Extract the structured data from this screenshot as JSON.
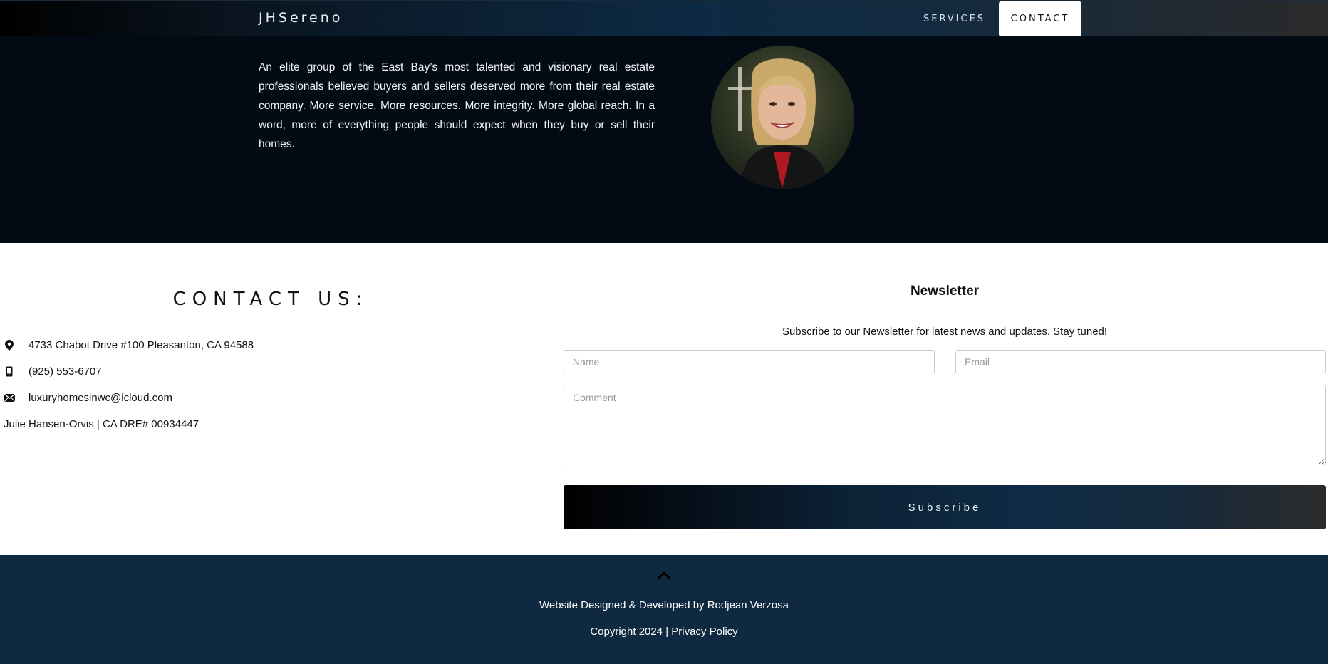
{
  "nav": {
    "brand": "JHSereno",
    "items": [
      {
        "label": "SERVICES"
      },
      {
        "label": "CONTACT"
      }
    ]
  },
  "about": {
    "text": "An elite group of the East Bay’s most talented and visionary real estate professionals believed buyers and sellers deserved more from their real estate company. More service. More resources. More integrity. More global reach. In a word, more of everything people should expect when they buy or sell their homes.",
    "portrait_icon": "agent-portrait-photo"
  },
  "contact": {
    "title": "CONTACT US:",
    "address": "4733 Chabot Drive #100 Pleasanton, CA 94588",
    "phone": "(925) 553-6707",
    "email": "luxuryhomesinwc@icloud.com",
    "license": "Julie Hansen-Orvis | CA DRE# 00934447",
    "icons": [
      "map-pin-icon",
      "phone-icon",
      "envelope-icon"
    ]
  },
  "newsletter": {
    "title": "Newsletter",
    "subtitle": "Subscribe to our Newsletter for latest news and updates. Stay tuned!",
    "name_placeholder": "Name",
    "email_placeholder": "Email",
    "comment_placeholder": "Comment",
    "name_value": "",
    "email_value": "",
    "comment_value": "",
    "button": "Subscribe"
  },
  "footer": {
    "credit": "Website Designed & Developed by Rodjean Verzosa",
    "copyright_prefix": "Copyright 2024 | ",
    "privacy": "Privacy Policy",
    "to_top_icon": "chevron-up-icon"
  },
  "colors": {
    "nav_mid": "#0d2a44",
    "hero_bg": "#020a14",
    "footer_bg": "#0e2940",
    "text_dark": "#111111",
    "text_light": "#ffffff"
  }
}
